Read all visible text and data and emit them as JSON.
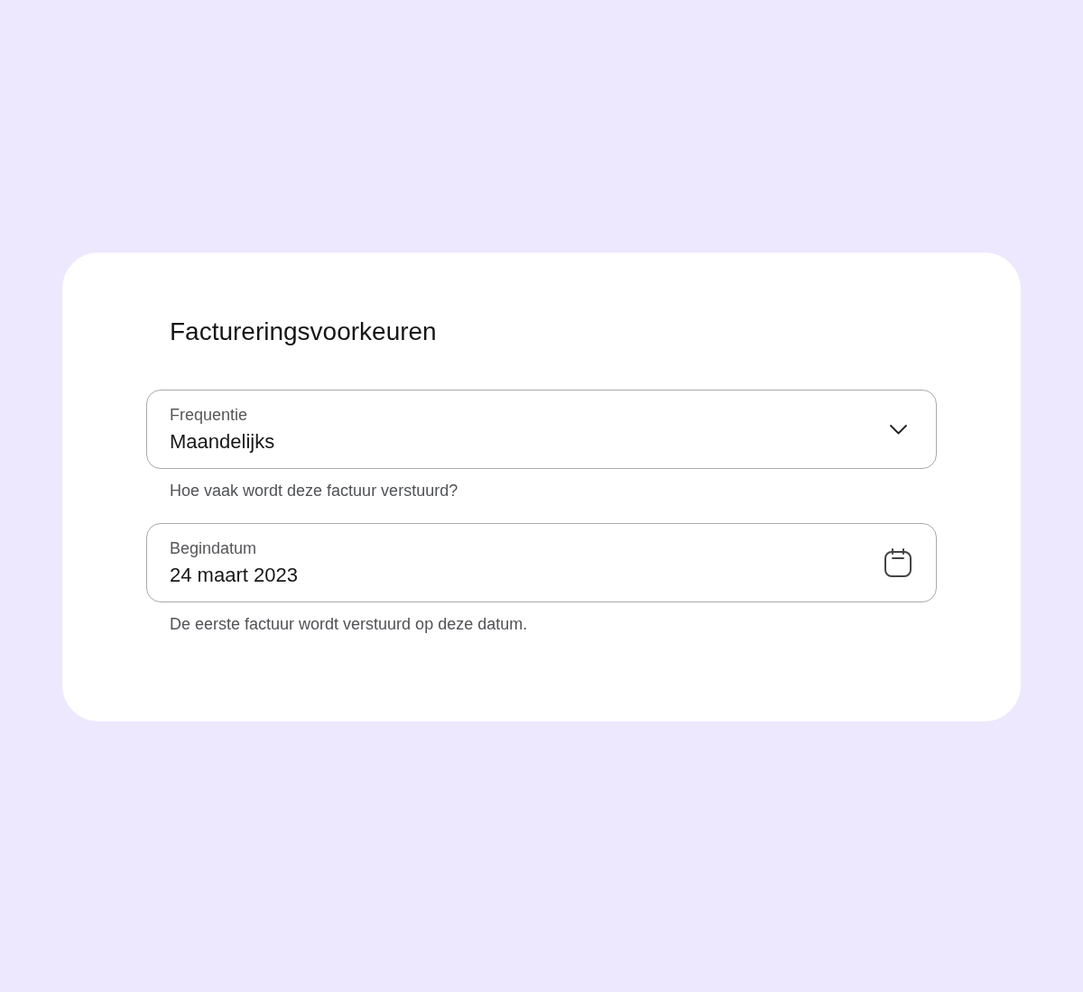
{
  "title": "Factureringsvoorkeuren",
  "fields": [
    {
      "kind": "select",
      "label": "Frequentie",
      "value": "Maandelijks",
      "helper": "Hoe vaak wordt deze factuur verstuurd?"
    },
    {
      "kind": "date",
      "label": "Begindatum",
      "value": "24 maart 2023",
      "helper": "De eerste factuur wordt verstuurd op deze datum."
    }
  ]
}
